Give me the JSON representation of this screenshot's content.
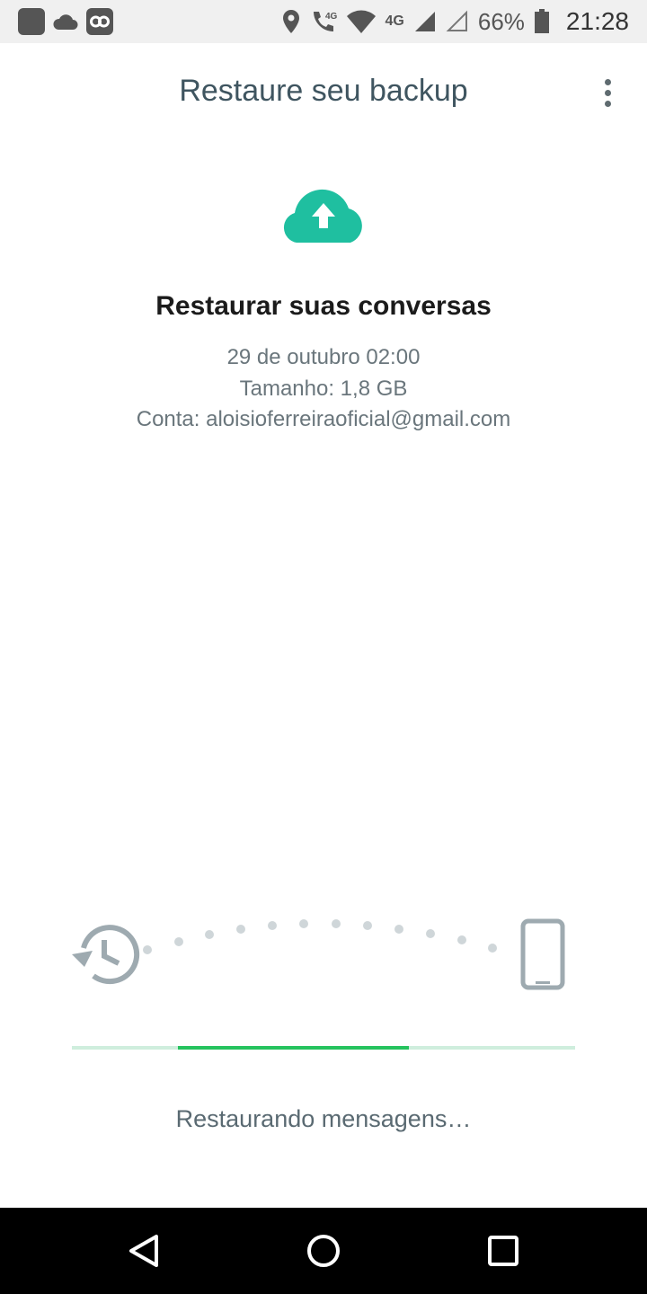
{
  "status_bar": {
    "network_label": "4G",
    "battery": "66%",
    "time": "21:28"
  },
  "header": {
    "title": "Restaure seu backup"
  },
  "main": {
    "heading": "Restaurar suas conversas",
    "date": "29 de outubro 02:00",
    "size": "Tamanho: 1,8 GB",
    "account": "Conta: aloisioferreiraoficial@gmail.com"
  },
  "progress": {
    "start_fraction": 0.21,
    "end_fraction": 0.67,
    "status_text": "Restaurando mensagens…"
  },
  "colors": {
    "accent": "#25c35e",
    "cloud": "#1fbfa0",
    "icon_gray": "#9eaab0"
  },
  "icons": [
    "gallery-icon",
    "cloud-icon",
    "link-icon",
    "location-icon",
    "wifi-call-icon",
    "wifi-icon",
    "signal-icon",
    "battery-icon",
    "more-vert-icon",
    "cloud-upload-icon",
    "history-icon",
    "phone-icon",
    "back-icon",
    "home-icon",
    "recents-icon"
  ]
}
